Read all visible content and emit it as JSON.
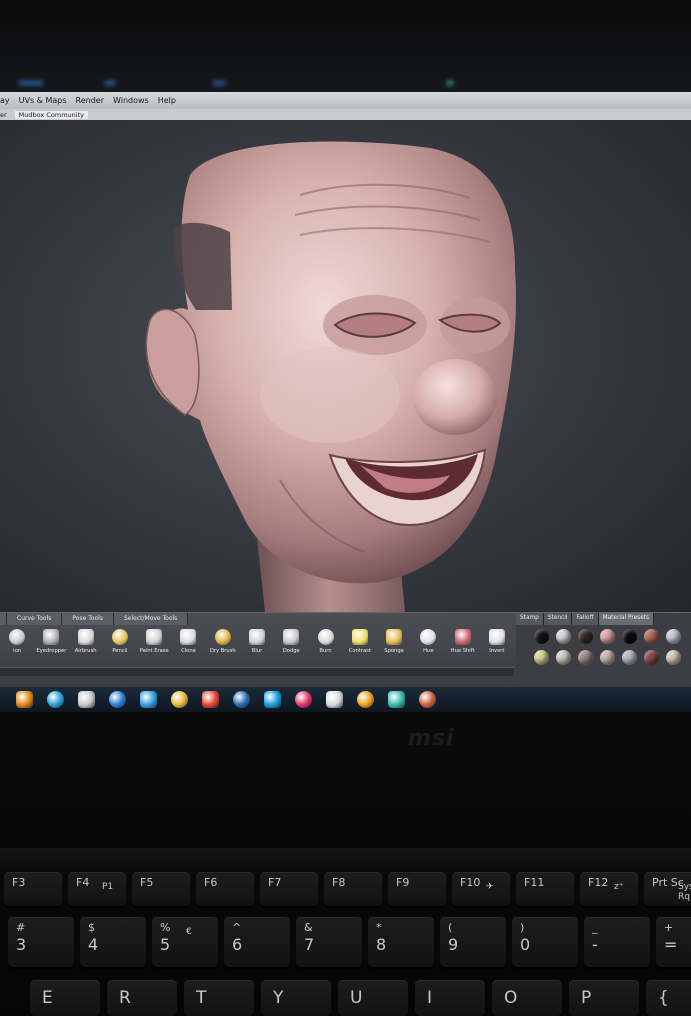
{
  "menubar": {
    "items": [
      "ay",
      "UVs & Maps",
      "Render",
      "Windows",
      "Help"
    ]
  },
  "subbar": {
    "items": [
      "er",
      "Mudbox Community"
    ]
  },
  "shelf": {
    "tabs": [
      "Curve Tools",
      "Pose Tools",
      "Select/Move Tools"
    ],
    "tools": [
      {
        "label": "ion",
        "icon": "partial-icon"
      },
      {
        "label": "Eyedropper",
        "icon": "eyedropper-icon"
      },
      {
        "label": "Airbrush",
        "icon": "airbrush-icon"
      },
      {
        "label": "Pencil",
        "icon": "pencil-icon"
      },
      {
        "label": "Paint Erase",
        "icon": "eraser-icon"
      },
      {
        "label": "Clone",
        "icon": "clone-icon"
      },
      {
        "label": "Dry Brush",
        "icon": "dry-brush-icon"
      },
      {
        "label": "Blur",
        "icon": "blur-icon"
      },
      {
        "label": "Dodge",
        "icon": "dodge-icon"
      },
      {
        "label": "Burn",
        "icon": "burn-icon"
      },
      {
        "label": "Contrast",
        "icon": "contrast-icon"
      },
      {
        "label": "Sponge",
        "icon": "sponge-icon"
      },
      {
        "label": "Hue",
        "icon": "hue-icon"
      },
      {
        "label": "Hue Shift",
        "icon": "hue-shift-icon"
      },
      {
        "label": "Invert",
        "icon": "invert-icon"
      }
    ]
  },
  "palette": {
    "tabs": [
      "Stamp",
      "Stencil",
      "Falloff",
      "Material Presets"
    ],
    "swatches": [
      "#141414",
      "#d8d8d8",
      "#3a2a24",
      "#e0a7a7",
      "#0c0c10",
      "#b06b5c",
      "#c7ccd6",
      "#d9d596",
      "#d0cdc4",
      "#9b8a84",
      "#c6b7b0",
      "#b8bcc4",
      "#8b4b48",
      "#d5c9bc"
    ]
  },
  "taskbar": {
    "icons": [
      {
        "name": "media-player-icon",
        "color": "#e58c1f"
      },
      {
        "name": "store-icon",
        "color": "#2aa3d8"
      },
      {
        "name": "settings-gear-icon",
        "color": "#cccccc"
      },
      {
        "name": "player-icon",
        "color": "#2e7fd6"
      },
      {
        "name": "photos-icon",
        "color": "#3aa6e0"
      },
      {
        "name": "folder-icon",
        "color": "#e8b93a"
      },
      {
        "name": "chrome-icon",
        "color": "#e8493a"
      },
      {
        "name": "browser-icon",
        "color": "#2b6fb0"
      },
      {
        "name": "messenger-icon",
        "color": "#1ea0e0"
      },
      {
        "name": "music-icon",
        "color": "#e2386b"
      },
      {
        "name": "notes-icon",
        "color": "#dddddd"
      },
      {
        "name": "firefox-icon",
        "color": "#f0a020"
      },
      {
        "name": "mudbox-icon",
        "color": "#3fbfb0"
      },
      {
        "name": "app-icon",
        "color": "#d06040"
      }
    ]
  },
  "laptop": {
    "logo": "msi",
    "keys_row1": [
      {
        "top": "F3"
      },
      {
        "top": "F4",
        "sub": "P1"
      },
      {
        "top": "F5"
      },
      {
        "top": "F6"
      },
      {
        "top": "F7"
      },
      {
        "top": "F8"
      },
      {
        "top": "F9"
      },
      {
        "top": "F10",
        "sub": "✈"
      },
      {
        "top": "F11"
      },
      {
        "top": "F12",
        "sub": "z⁺"
      },
      {
        "top": "Prt Sc",
        "sub": "Sys Rq"
      }
    ],
    "keys_row2": [
      {
        "top": "#",
        "mid": "3"
      },
      {
        "top": "$",
        "mid": "4"
      },
      {
        "top": "%",
        "mid": "5",
        "sub": "€"
      },
      {
        "top": "^",
        "mid": "6"
      },
      {
        "top": "&",
        "mid": "7"
      },
      {
        "top": "*",
        "mid": "8"
      },
      {
        "top": "(",
        "mid": "9"
      },
      {
        "top": ")",
        "mid": "0"
      },
      {
        "top": "_",
        "mid": "-"
      },
      {
        "top": "+",
        "mid": "="
      }
    ],
    "keys_row3": [
      "E",
      "R",
      "T",
      "Y",
      "U",
      "I",
      "O",
      "P",
      "{"
    ]
  }
}
